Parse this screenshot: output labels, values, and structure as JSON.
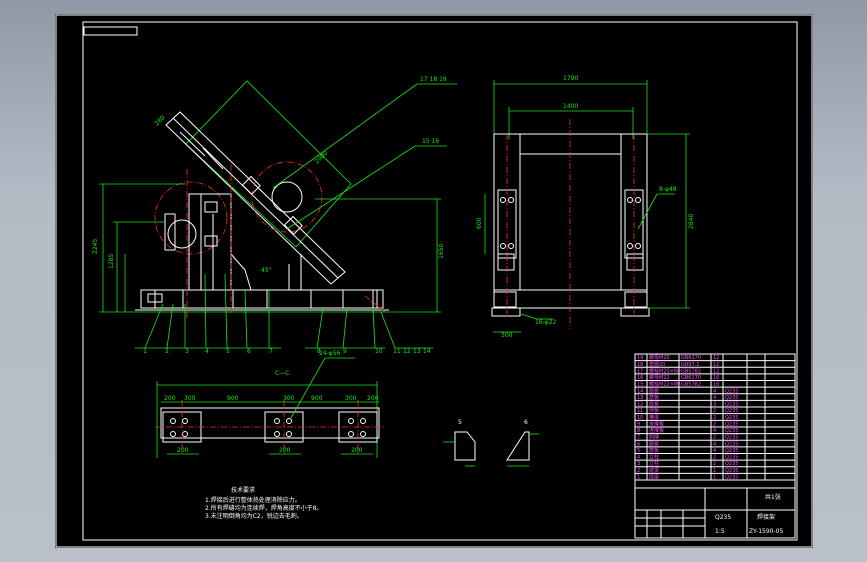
{
  "drawing": {
    "colors": {
      "background": "#000000",
      "outline": "#ffffff",
      "dimension": "#19e619",
      "centerline": "#ff2a2a",
      "text": "#ffffff"
    },
    "part_labels": [
      "1",
      "2",
      "3",
      "4",
      "5",
      "6",
      "7",
      "8",
      "9",
      "10",
      "11",
      "12",
      "13",
      "14"
    ],
    "callouts": {
      "top_right": "17 18 19",
      "mid_right": "15 16"
    },
    "dimensions": {
      "side_width": "1790",
      "side_inner": "1400",
      "side_height": "2840",
      "base_bolts": "24-φ56",
      "side_bolts": "16-φ22",
      "detail_bolt": "8-φ48",
      "base_span_a": "900",
      "base_span_b": "900",
      "base_pad_a": "300",
      "base_pad_b": "300",
      "base_pad_c": "300",
      "base_edge_l": "200",
      "base_edge_r": "200",
      "foot_w": "300",
      "angle": "45°"
    },
    "section_marks": {
      "a": "5",
      "b": "6",
      "base": "C—C"
    },
    "notes_title": "技术要求",
    "notes": [
      "1.焊接后进行整体热处理消除应力。",
      "2.所有焊缝均为连续焊，焊角高度不小于8。",
      "3.未注明倒角均为C2，锐边去毛刺。"
    ],
    "title_block": {
      "title": "焊接架",
      "drawing_no": "ZY-1590-05",
      "scale": "1:5",
      "sheet": "共1张",
      "material": "Q235",
      "rows": [
        [
          "19",
          "螺母M20",
          "GB6170",
          "12",
          "",
          "",
          ""
        ],
        [
          "18",
          "垫圈20",
          "GB97.1",
          "12",
          "",
          "",
          ""
        ],
        [
          "17",
          "螺栓M20×60",
          "GB5782",
          "12",
          "",
          "",
          ""
        ],
        [
          "16",
          "螺母M22",
          "GB6170",
          "16",
          "",
          "",
          ""
        ],
        [
          "15",
          "螺栓M22×80",
          "GB5782",
          "16",
          "",
          "",
          ""
        ],
        [
          "14",
          "筋板",
          "",
          "4",
          "Q235",
          "",
          ""
        ],
        [
          "13",
          "筋板",
          "",
          "4",
          "Q235",
          "",
          ""
        ],
        [
          "12",
          "底板",
          "",
          "3",
          "Q235",
          "",
          ""
        ],
        [
          "11",
          "侧板",
          "",
          "2",
          "Q235",
          "",
          ""
        ],
        [
          "10",
          "横梁",
          "",
          "2",
          "Q235",
          "",
          ""
        ],
        [
          "9",
          "支撑板",
          "",
          "2",
          "Q235",
          "",
          ""
        ],
        [
          "8",
          "连接板",
          "",
          "4",
          "Q235",
          "",
          ""
        ],
        [
          "7",
          "斜撑",
          "",
          "2",
          "Q235",
          "",
          ""
        ],
        [
          "6",
          "筋板",
          "",
          "4",
          "Q235",
          "",
          ""
        ],
        [
          "5",
          "筋板",
          "",
          "4",
          "Q235",
          "",
          ""
        ],
        [
          "4",
          "立柱",
          "",
          "2",
          "Q235",
          "",
          ""
        ],
        [
          "3",
          "立柱",
          "",
          "2",
          "Q235",
          "",
          ""
        ],
        [
          "2",
          "底梁",
          "",
          "1",
          "Q235",
          "",
          ""
        ],
        [
          "1",
          "底座",
          "",
          "1",
          "Q235",
          "",
          ""
        ]
      ]
    }
  }
}
